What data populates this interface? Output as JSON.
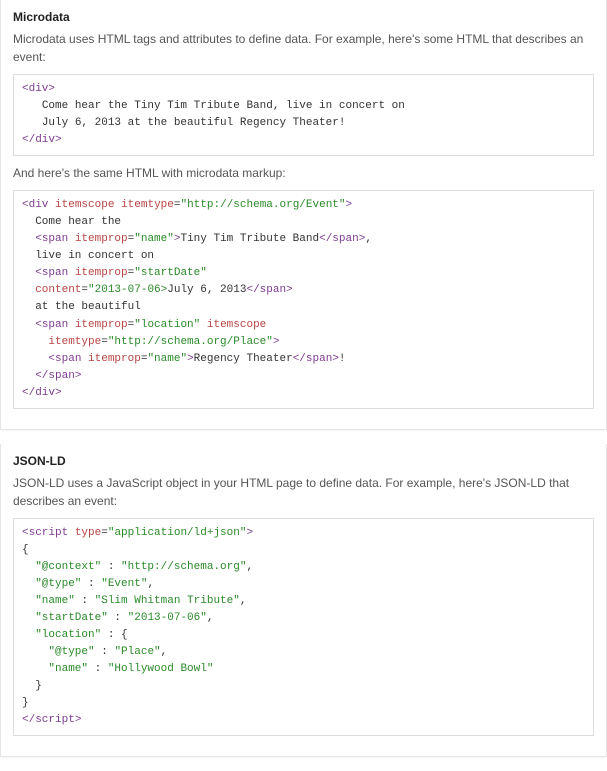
{
  "sections": {
    "microdata": {
      "heading": "Microdata",
      "intro": "Microdata uses HTML tags and attributes to define data. For example, here's some HTML that describes an event:",
      "bridge": "And here's the same HTML with microdata markup:"
    },
    "jsonld": {
      "heading": "JSON-LD",
      "intro": "JSON-LD uses a JavaScript object in your HTML page to define data. For example, here's JSON-LD that describes an event:"
    }
  },
  "code": {
    "plain_html": {
      "tag_open": "div",
      "line1_text": "Come hear the Tiny Tim Tribute Band, live in concert on",
      "line2_text": "July 6, 2013 at the beautiful Regency Theater!",
      "tag_close": "div"
    },
    "microdata_html": {
      "div_tag": "div",
      "attr_itemscope": "itemscope",
      "attr_itemtype": "itemtype",
      "itemtype_event": "\"http://schema.org/Event\"",
      "text_come_hear": "Come hear the",
      "span_tag": "span",
      "attr_itemprop": "itemprop",
      "itemprop_name": "\"name\"",
      "band_name": "Tiny Tim Tribute Band",
      "text_live": "live in concert on",
      "itemprop_startDate": "\"startDate\"",
      "attr_content": "content",
      "content_date": "\"2013-07-06>",
      "date_text": "July 6, 2013",
      "text_at_the": "at the beautiful",
      "itemprop_location": "\"location\"",
      "itemtype_place": "\"http://schema.org/Place\"",
      "theater_name": "Regency Theater",
      "comma": ",",
      "excl": "!"
    },
    "jsonld": {
      "script_tag": "script",
      "attr_type": "type",
      "type_val": "\"application/ld+json\"",
      "open_brace": "{",
      "close_brace": "}",
      "key_context": "\"@context\"",
      "val_context": "\"http://schema.org\"",
      "key_type": "\"@type\"",
      "val_event": "\"Event\"",
      "key_name": "\"name\"",
      "val_name": "\"Slim Whitman Tribute\"",
      "key_startDate": "\"startDate\"",
      "val_startDate": "\"2013-07-06\"",
      "key_location": "\"location\"",
      "val_place": "\"Place\"",
      "val_loc_name": "\"Hollywood Bowl\"",
      "colon_sep": " : ",
      "comma": ","
    }
  }
}
